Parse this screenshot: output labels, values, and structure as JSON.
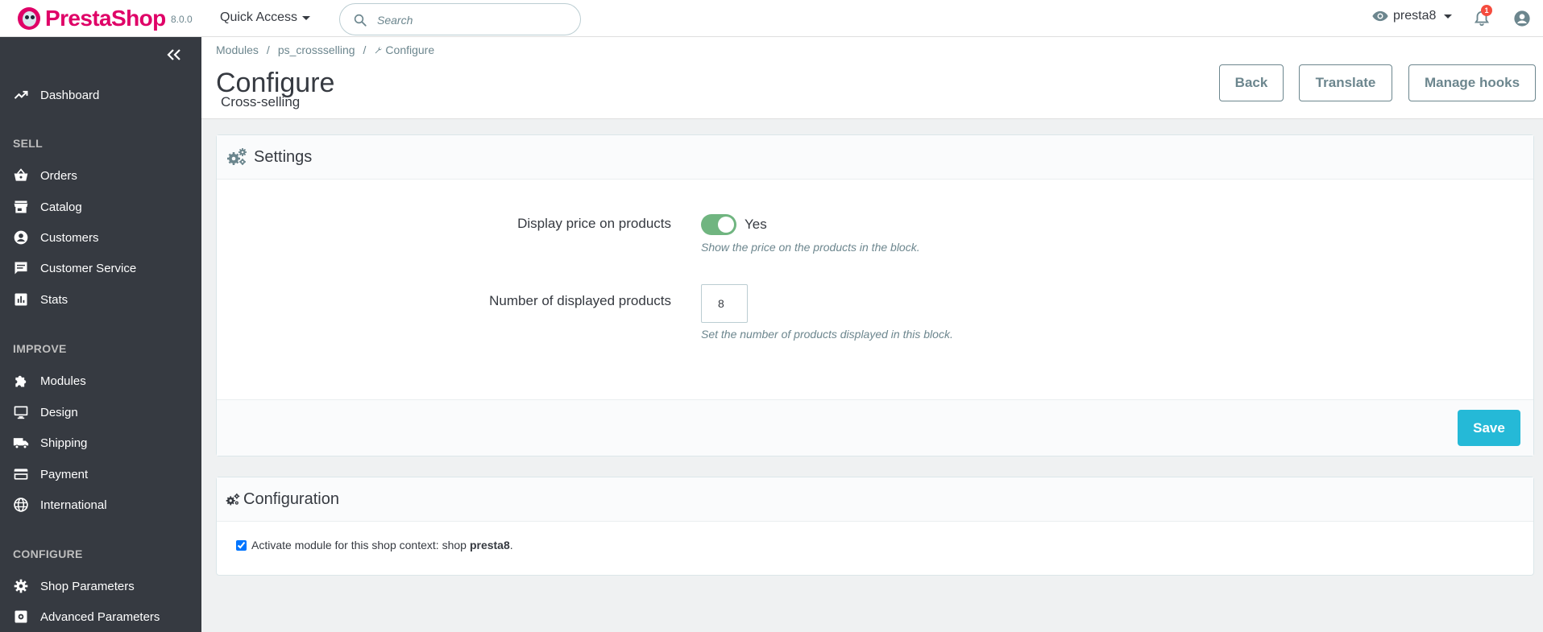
{
  "topbar": {
    "brand": "PrestaShop",
    "version": "8.0.0",
    "quick_access": "Quick Access",
    "search_placeholder": "Search",
    "shop_name": "presta8",
    "notification_count": "1"
  },
  "sidebar": {
    "dashboard": "Dashboard",
    "sections": {
      "sell": "SELL",
      "improve": "IMPROVE",
      "configure": "CONFIGURE"
    },
    "sell_items": [
      "Orders",
      "Catalog",
      "Customers",
      "Customer Service",
      "Stats"
    ],
    "improve_items": [
      "Modules",
      "Design",
      "Shipping",
      "Payment",
      "International"
    ],
    "configure_items": [
      "Shop Parameters",
      "Advanced Parameters"
    ]
  },
  "breadcrumb": {
    "items": [
      "Modules",
      "ps_crossselling",
      "Configure"
    ]
  },
  "header": {
    "title": "Configure",
    "subtitle": "Cross-selling",
    "buttons": {
      "back": "Back",
      "translate": "Translate",
      "manage_hooks": "Manage hooks"
    }
  },
  "settings_panel": {
    "title": "Settings",
    "display_price": {
      "label": "Display price on products",
      "value": "Yes",
      "help": "Show the price on the products in the block."
    },
    "num_products": {
      "label": "Number of displayed products",
      "value": "8",
      "help": "Set the number of products displayed in this block."
    },
    "save": "Save"
  },
  "config_panel": {
    "title": "Configuration",
    "checkbox_text": "Activate module for this shop context: shop",
    "shop": "presta8",
    "suffix": "."
  },
  "colors": {
    "brand": "#df0067",
    "sidebar_bg": "#363a41",
    "primary": "#25b9d7",
    "switch_on": "#70b580"
  }
}
